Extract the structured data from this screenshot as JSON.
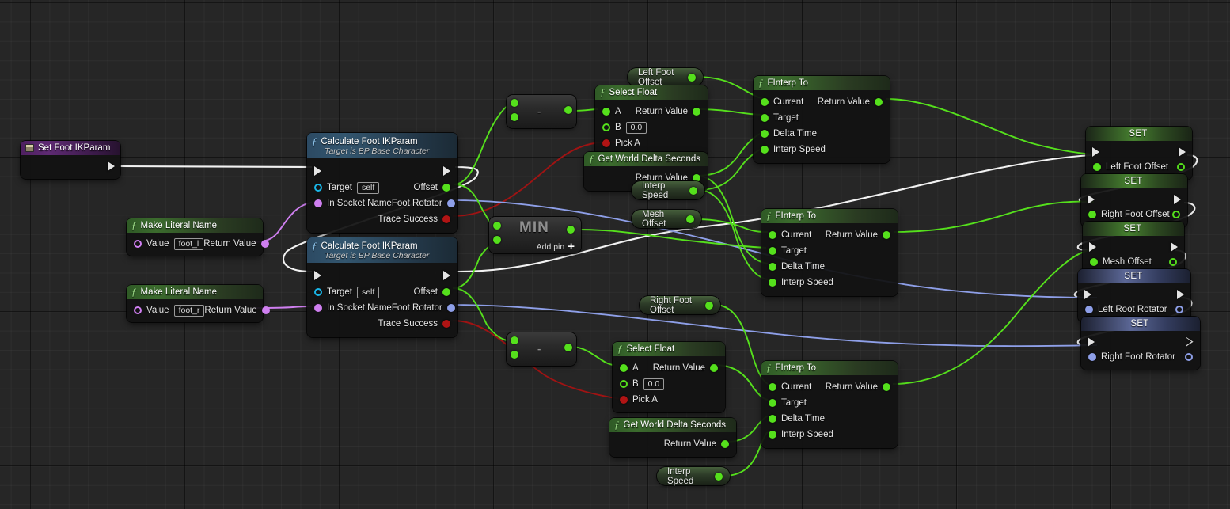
{
  "app": {
    "name": "Unreal Engine Blueprint Graph",
    "canvas_bg": "#262626"
  },
  "colors": {
    "exec_wire": "#ffffff",
    "float_wire": "#55e01c",
    "rotator_wire": "#8e9fe8",
    "bool_wire": "#b11414",
    "name_wire": "#cf7ff0",
    "float_pin": "#55e01c",
    "rotator_pin": "#8e9fe8",
    "bool_pin": "#b11414",
    "name_pin": "#cf7ff0",
    "object_pin": "#19b6e8"
  },
  "nodes": {
    "set_foot_ikparam": {
      "title": "Set Foot IKParam",
      "type": "event"
    },
    "make_literal_name_left": {
      "title": "Make Literal Name",
      "input_label": "Value",
      "input_value": "foot_l",
      "output_label": "Return Value"
    },
    "make_literal_name_right": {
      "title": "Make Literal Name",
      "input_label": "Value",
      "input_value": "foot_r",
      "output_label": "Return Value"
    },
    "calculate_foot_ikparam_left": {
      "title": "Calculate Foot IKParam",
      "subtitle": "Target is BP Base Character",
      "inputs": [
        {
          "label": "Target",
          "value": "self"
        },
        {
          "label": "In Socket Name"
        }
      ],
      "outputs": [
        {
          "label": "Offset"
        },
        {
          "label": "Foot Rotator"
        },
        {
          "label": "Trace Success"
        }
      ]
    },
    "calculate_foot_ikparam_right": {
      "title": "Calculate Foot IKParam",
      "subtitle": "Target is BP Base Character",
      "inputs": [
        {
          "label": "Target",
          "value": "self"
        },
        {
          "label": "In Socket Name"
        }
      ],
      "outputs": [
        {
          "label": "Offset"
        },
        {
          "label": "Foot Rotator"
        },
        {
          "label": "Trace Success"
        }
      ]
    },
    "subtract_top": {
      "operator": "-"
    },
    "subtract_bottom": {
      "operator": "-"
    },
    "min_node": {
      "operator": "MIN",
      "add_pin_label": "Add pin"
    },
    "select_float_top": {
      "title": "Select Float",
      "inputs": [
        {
          "label": "A"
        },
        {
          "label": "B",
          "value": "0.0"
        },
        {
          "label": "Pick A"
        }
      ],
      "outputs": [
        {
          "label": "Return Value"
        }
      ]
    },
    "select_float_bottom": {
      "title": "Select Float",
      "inputs": [
        {
          "label": "A"
        },
        {
          "label": "B",
          "value": "0.0"
        },
        {
          "label": "Pick A"
        }
      ],
      "outputs": [
        {
          "label": "Return Value"
        }
      ]
    },
    "get_world_delta_top": {
      "title": "Get World Delta Seconds",
      "outputs": [
        {
          "label": "Return Value"
        }
      ]
    },
    "get_world_delta_bottom": {
      "title": "Get World Delta Seconds",
      "outputs": [
        {
          "label": "Return Value"
        }
      ]
    },
    "finterp_to_1": {
      "title": "FInterp To",
      "inputs": [
        {
          "label": "Current"
        },
        {
          "label": "Target"
        },
        {
          "label": "Delta Time"
        },
        {
          "label": "Interp Speed"
        }
      ],
      "outputs": [
        {
          "label": "Return Value"
        }
      ]
    },
    "finterp_to_2": {
      "title": "FInterp To",
      "inputs": [
        {
          "label": "Current"
        },
        {
          "label": "Target"
        },
        {
          "label": "Delta Time"
        },
        {
          "label": "Interp Speed"
        }
      ],
      "outputs": [
        {
          "label": "Return Value"
        }
      ]
    },
    "finterp_to_3": {
      "title": "FInterp To",
      "inputs": [
        {
          "label": "Current"
        },
        {
          "label": "Target"
        },
        {
          "label": "Delta Time"
        },
        {
          "label": "Interp Speed"
        }
      ],
      "outputs": [
        {
          "label": "Return Value"
        }
      ]
    }
  },
  "getters": {
    "left_foot_offset": {
      "label": "Left Foot Offset"
    },
    "interp_speed_top": {
      "label": "Interp Speed"
    },
    "mesh_offset": {
      "label": "Mesh Offset"
    },
    "right_foot_offset": {
      "label": "Right Foot Offset"
    },
    "interp_speed_bottom": {
      "label": "Interp Speed"
    }
  },
  "setters": [
    {
      "header": "SET",
      "variable": "Left Foot Offset",
      "pin_type": "float"
    },
    {
      "header": "SET",
      "variable": "Right Foot Offset",
      "pin_type": "float"
    },
    {
      "header": "SET",
      "variable": "Mesh Offset",
      "pin_type": "float"
    },
    {
      "header": "SET",
      "variable": "Left Root Rotator",
      "pin_type": "rotator"
    },
    {
      "header": "SET",
      "variable": "Right Foot Rotator",
      "pin_type": "rotator"
    }
  ]
}
